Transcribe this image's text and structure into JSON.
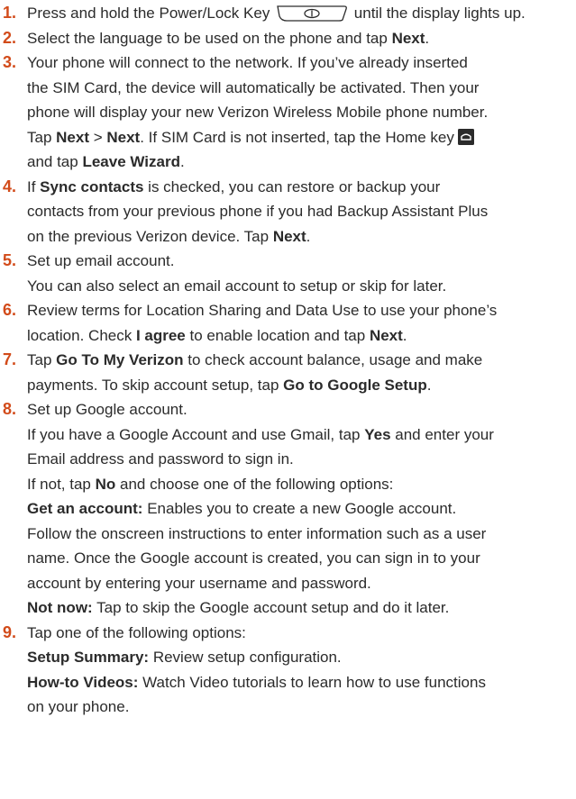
{
  "colors": {
    "step_number": "#d24b1a",
    "text": "#2b2b2b"
  },
  "icons": {
    "power_key": "power-lock-key-icon",
    "home_key": "home-key-icon"
  },
  "steps": [
    {
      "num": "1.",
      "l1_a": "Press and hold the Power/Lock Key",
      "l1_b": "until the display lights up."
    },
    {
      "num": "2.",
      "l1_a": "Select the language to be used on the phone and tap ",
      "l1_b": "Next",
      "l1_c": "."
    },
    {
      "num": "3.",
      "l1": "Your phone will connect to the network. If you’ve already inserted",
      "l2": "the SIM Card, the device will automatically be activated. Then your",
      "l3": "phone will display your new Verizon Wireless Mobile phone number.",
      "l4_a": "Tap ",
      "l4_b": "Next",
      "l4_c": " > ",
      "l4_d": "Next",
      "l4_e": ". If SIM Card is not inserted, tap the Home key",
      "l5_a": "and tap ",
      "l5_b": "Leave Wizard",
      "l5_c": "."
    },
    {
      "num": "4.",
      "l1_a": "If ",
      "l1_b": "Sync contacts",
      "l1_c": " is checked, you can restore or backup your",
      "l2": "contacts from your previous phone if you had Backup Assistant Plus",
      "l3_a": "on the previous Verizon device. Tap ",
      "l3_b": "Next",
      "l3_c": "."
    },
    {
      "num": "5.",
      "l1": "Set up email account.",
      "l2": "You can also select an email account to setup or skip for later."
    },
    {
      "num": "6.",
      "l1": "Review terms for Location Sharing and Data Use to use your phone’s",
      "l2_a": "location. Check ",
      "l2_b": "I agree",
      "l2_c": " to enable location and tap ",
      "l2_d": "Next",
      "l2_e": "."
    },
    {
      "num": "7.",
      "l1_a": "Tap ",
      "l1_b": "Go To My Verizon",
      "l1_c": " to check account balance, usage and make",
      "l2_a": "payments. To skip account setup, tap ",
      "l2_b": "Go to Google Setup",
      "l2_c": "."
    },
    {
      "num": "8.",
      "l1": "Set up Google account.",
      "l2_a": "If you have a Google Account and use Gmail, tap ",
      "l2_b": "Yes",
      "l2_c": " and enter your",
      "l3": "Email address and password to sign in.",
      "l4_a": "If not, tap ",
      "l4_b": "No",
      "l4_c": " and choose one of the following options:",
      "l5_a": "Get an account:",
      "l5_b": " Enables you to create a new Google account.",
      "l6": "Follow the onscreen instructions to enter information such as a user",
      "l7": "name. Once the Google account is created, you can sign in to your",
      "l8": "account by entering your username and password.",
      "l9_a": "Not now:",
      "l9_b": " Tap to skip the Google account setup and do it later."
    },
    {
      "num": "9.",
      "l1": "Tap one of the following options:",
      "l2_a": "Setup Summary:",
      "l2_b": " Review setup configuration.",
      "l3_a": "How-to Videos:",
      "l3_b": " Watch Video tutorials to learn how to use functions",
      "l4": "on your phone."
    }
  ]
}
